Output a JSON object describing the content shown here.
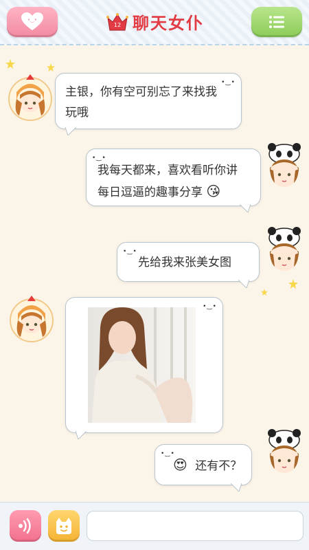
{
  "header": {
    "title": "聊天女仆",
    "crown_badge": "12",
    "left_icon": "heart-bubble-icon",
    "right_icon": "menu-list-icon"
  },
  "messages": [
    {
      "sender": "bot",
      "text_line1": "主银，你有空可别忘了来找我",
      "text_line2": "玩哦"
    },
    {
      "sender": "user",
      "text_line1": "我每天都来，喜欢看听你讲",
      "text_line2": "每日逗逼的趣事分享",
      "emoji": "😘"
    },
    {
      "sender": "user",
      "text": "先给我来张美女图"
    },
    {
      "sender": "bot",
      "type": "image",
      "image": "photo-girl-in-white-sweater"
    },
    {
      "sender": "user",
      "emoji": "😍",
      "text": "还有不？"
    }
  ],
  "bubble_face": "•‿•",
  "input_bar": {
    "voice_icon": "voice-wave-icon",
    "emoji_icon": "smiley-face-icon",
    "placeholder": ""
  },
  "colors": {
    "title_red": "#e23b43",
    "left_button_pink": "#f28aa2",
    "right_button_green": "#8ccc58",
    "background_cream": "#fbf4e8"
  }
}
